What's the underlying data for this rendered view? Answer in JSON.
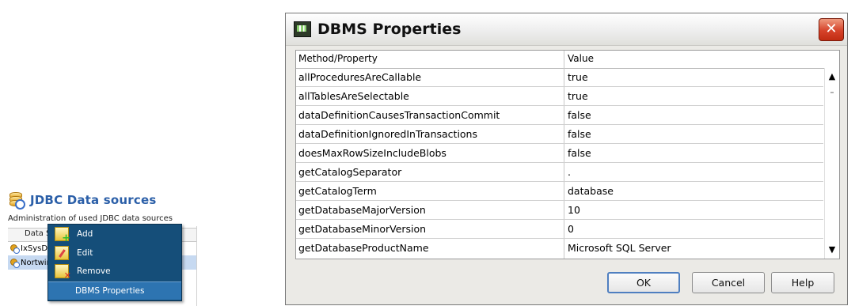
{
  "jdbc_panel": {
    "title": "JDBC Data sources",
    "subtitle": "Administration of used JDBC data sources",
    "column_header": "Data Source",
    "rows": [
      {
        "label": "IxSysDb"
      },
      {
        "label": "Nortwind"
      }
    ]
  },
  "context_menu": {
    "items": [
      {
        "label": "Add",
        "icon": "add-icon"
      },
      {
        "label": "Edit",
        "icon": "edit-icon"
      },
      {
        "label": "Remove",
        "icon": "remove-icon"
      },
      {
        "label": "DBMS Properties",
        "icon": ""
      }
    ]
  },
  "dialog": {
    "title": "DBMS Properties",
    "close_label": "✕",
    "columns": {
      "property": "Method/Property",
      "value": "Value"
    },
    "rows": [
      {
        "property": "allProceduresAreCallable",
        "value": "true"
      },
      {
        "property": "allTablesAreSelectable",
        "value": "true"
      },
      {
        "property": "dataDefinitionCausesTransactionCommit",
        "value": "false"
      },
      {
        "property": "dataDefinitionIgnoredInTransactions",
        "value": "false"
      },
      {
        "property": "doesMaxRowSizeIncludeBlobs",
        "value": "false"
      },
      {
        "property": "getCatalogSeparator",
        "value": "."
      },
      {
        "property": "getCatalogTerm",
        "value": "database"
      },
      {
        "property": "getDatabaseMajorVersion",
        "value": "10"
      },
      {
        "property": "getDatabaseMinorVersion",
        "value": "0"
      },
      {
        "property": "getDatabaseProductName",
        "value": "Microsoft SQL Server"
      }
    ],
    "buttons": {
      "ok": "OK",
      "cancel": "Cancel",
      "help": "Help"
    },
    "colors": {
      "accent": "#4f7fc0",
      "menu_bg": "#154e79",
      "close": "#d6432a"
    }
  }
}
